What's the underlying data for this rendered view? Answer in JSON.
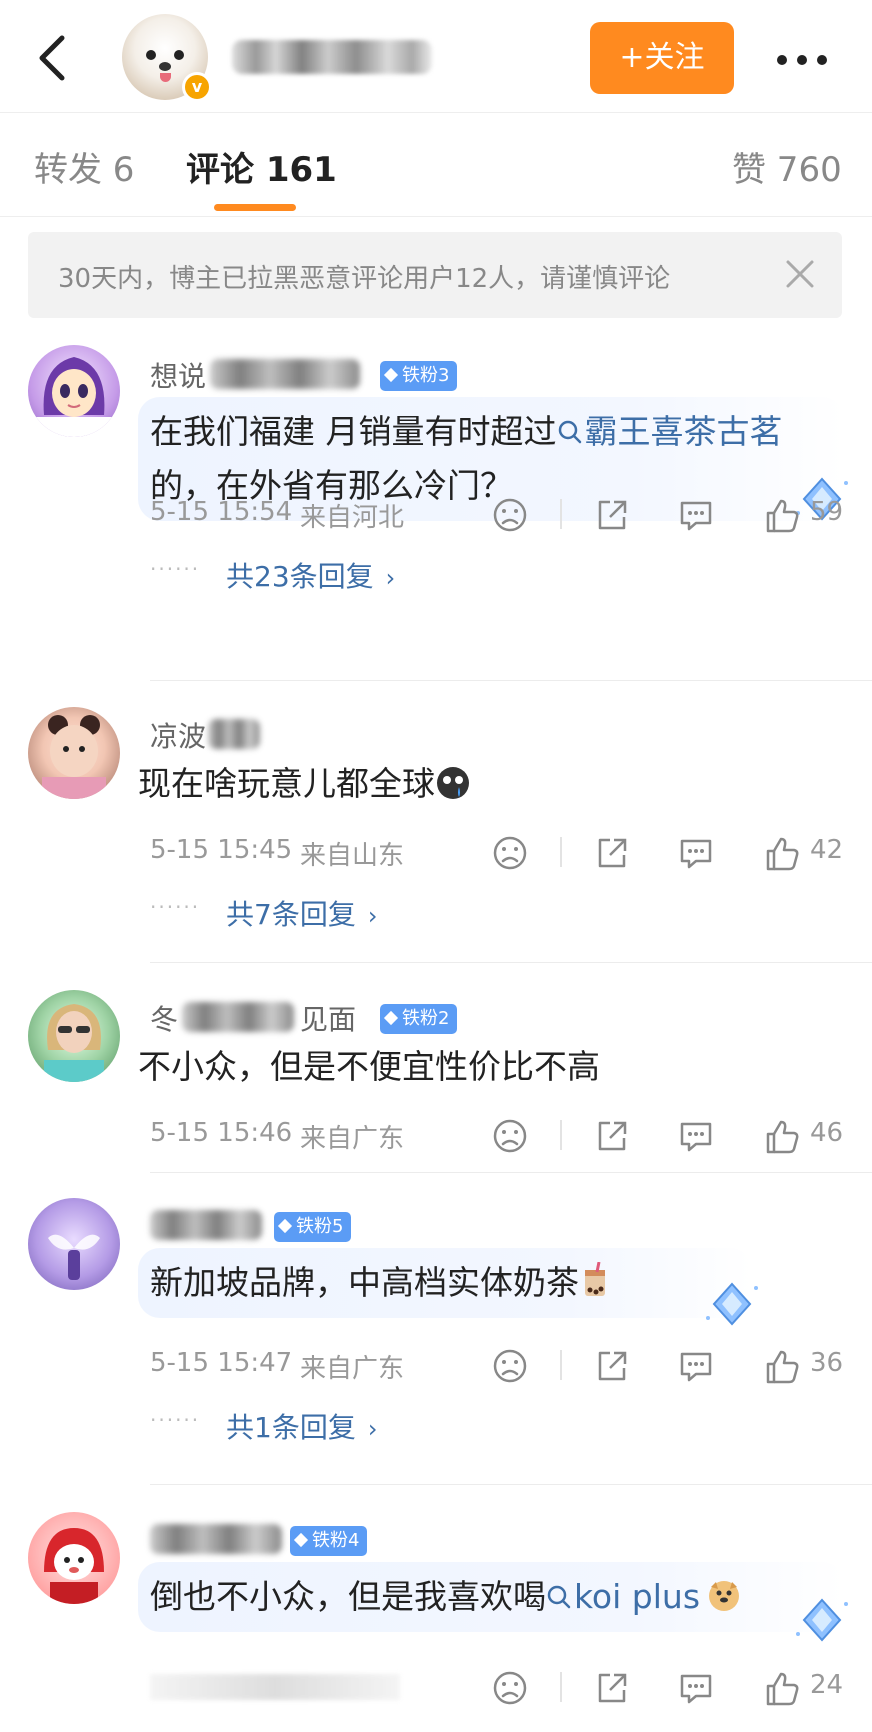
{
  "header": {
    "follow_label": "+关注"
  },
  "tabs": [
    {
      "label": "转发 6"
    },
    {
      "label": "评论 161"
    },
    {
      "label": "赞 760"
    }
  ],
  "notice": {
    "text": "30天内，博主已拉黑恶意评论用户12人，请谨慎评论"
  },
  "comments": [
    {
      "name_visible": "想说",
      "badge": "铁粉3",
      "text_plain": "在我们福建 月销量有时超过",
      "topic": "霸王喜茶古茗",
      "text_after": " 的，在外省有那么冷门？",
      "time": "5-15 15:54",
      "location": "来自河北",
      "likes": "59",
      "replies": "共23条回复"
    },
    {
      "name_visible": "凉波",
      "badge": "",
      "text_plain": "现在啥玩意儿都全球",
      "time": "5-15 15:45",
      "location": "来自山东",
      "likes": "42",
      "replies": "共7条回复"
    },
    {
      "name_visible": "冬",
      "name_visible_2": "见面",
      "badge": "铁粉2",
      "text_plain": "不小众，但是不便宜性价比不高",
      "time": "5-15 15:46",
      "location": "来自广东",
      "likes": "46"
    },
    {
      "name_visible": "",
      "badge": "铁粉5",
      "text_plain": "新加坡品牌，中高档实体奶茶",
      "time": "5-15 15:47",
      "location": "来自广东",
      "likes": "36",
      "replies": "共1条回复"
    },
    {
      "name_visible": "",
      "badge": "铁粉4",
      "text_plain": "倒也不小众，但是我喜欢喝",
      "topic": "koi plus",
      "likes": "24"
    }
  ],
  "icons": {
    "back": "chevron-left-icon",
    "more": "more-dots-icon",
    "close": "close-icon",
    "sad": "sad-face-icon",
    "share": "share-icon",
    "comment": "comment-icon",
    "like": "thumbs-up-icon"
  },
  "colors": {
    "accent": "#ff8a1f",
    "link": "#3d6ea7",
    "badge": "#5b9cf5"
  }
}
